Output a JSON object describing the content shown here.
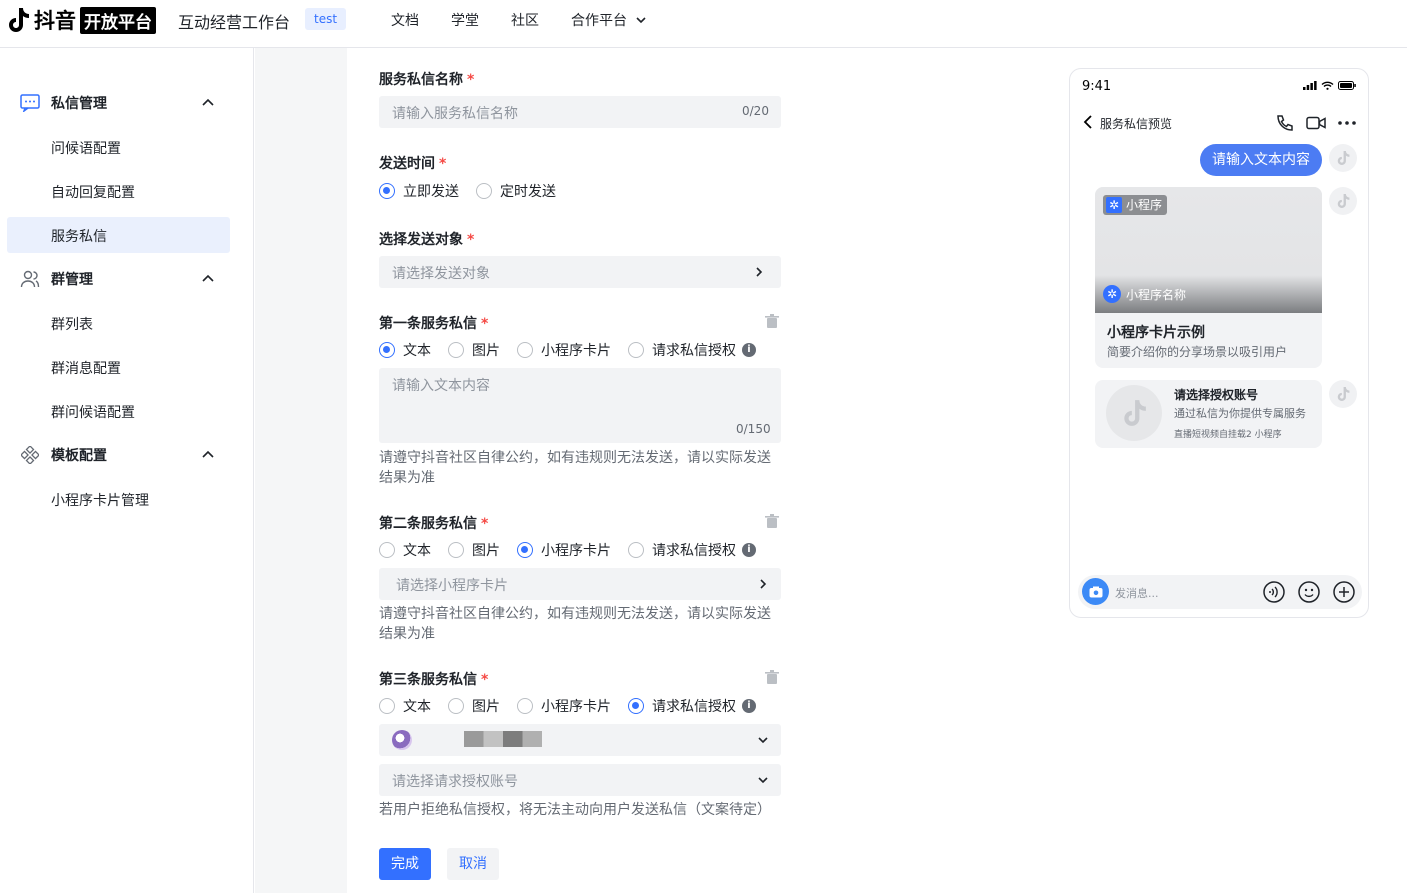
{
  "header": {
    "logo_text": "抖音",
    "logo_badge": "开放平台",
    "app_title": "互动经营工作台",
    "env_tag": "test",
    "nav": [
      "文档",
      "学堂",
      "社区",
      "合作平台"
    ]
  },
  "sidebar": {
    "groups": [
      {
        "label": "私信管理",
        "icon": "message-icon",
        "items": [
          "问候语配置",
          "自动回复配置",
          "服务私信"
        ]
      },
      {
        "label": "群管理",
        "icon": "group-users-icon",
        "items": [
          "群列表",
          "群消息配置",
          "群问候语配置"
        ]
      },
      {
        "label": "模板配置",
        "icon": "template-grid-icon",
        "items": [
          "小程序卡片管理"
        ]
      }
    ],
    "active_item": "服务私信"
  },
  "form": {
    "name": {
      "label": "服务私信名称",
      "placeholder": "请输入服务私信名称",
      "counter": "0/20"
    },
    "send_time": {
      "label": "发送时间",
      "options": [
        "立即发送",
        "定时发送"
      ],
      "selected": "立即发送"
    },
    "target": {
      "label": "选择发送对象",
      "placeholder": "请选择发送对象"
    },
    "msg_types": [
      "文本",
      "图片",
      "小程序卡片",
      "请求私信授权"
    ],
    "first": {
      "label": "第一条服务私信",
      "selected": "文本",
      "text_placeholder": "请输入文本内容",
      "counter": "0/150",
      "hint": "请遵守抖音社区自律公约，如有违规则无法发送，请以实际发送结果为准"
    },
    "second": {
      "label": "第二条服务私信",
      "selected": "小程序卡片",
      "select_placeholder": "请选择小程序卡片",
      "hint": "请遵守抖音社区自律公约，如有违规则无法发送，请以实际发送结果为准"
    },
    "third": {
      "label": "第三条服务私信",
      "selected": "请求私信授权",
      "account_placeholder": "请选择请求授权账号",
      "hint": "若用户拒绝私信授权，将无法主动向用户发送私信（文案待定）"
    },
    "buttons": {
      "submit": "完成",
      "cancel": "取消"
    },
    "required_mark": "*"
  },
  "preview": {
    "time": "9:41",
    "title": "服务私信预览",
    "text_bubble": "请输入文本内容",
    "mini_program_tag": "小程序",
    "mini_program_name": "小程序名称",
    "card_title": "小程序卡片示例",
    "card_desc": "简要介绍你的分享场景以吸引用户",
    "auth_title": "请选择授权账号",
    "auth_desc": "通过私信为你提供专属服务",
    "auth_sub": "直播短视频自挂载2 小程序",
    "input_placeholder": "发消息..."
  },
  "colors": {
    "primary": "#3370ff",
    "required": "#f54a45",
    "bubble": "#4c7cf3",
    "active_bg": "#eaf0fd"
  }
}
